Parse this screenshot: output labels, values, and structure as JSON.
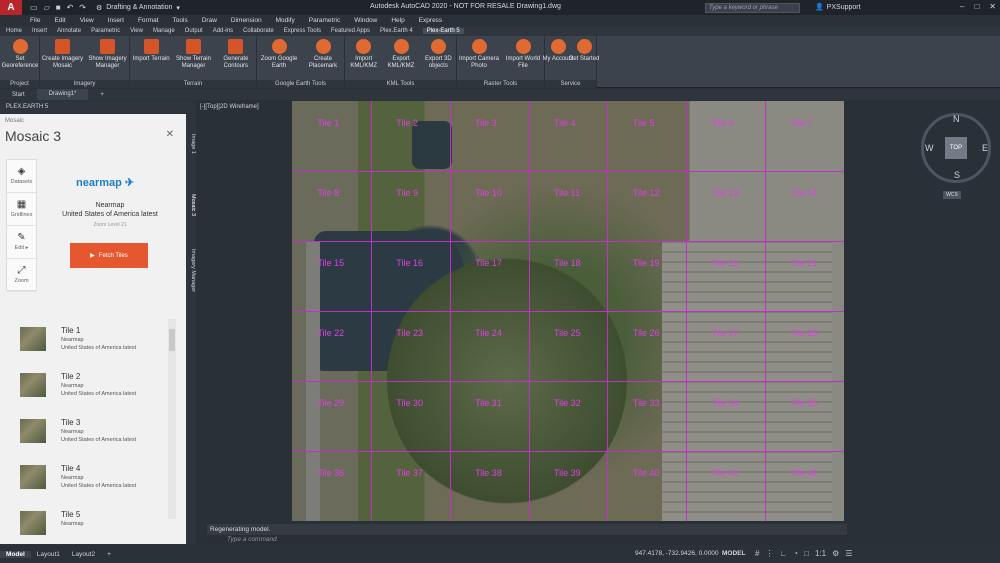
{
  "titlebar": {
    "logo": "A",
    "workspace": "Drafting & Annotation",
    "app_title": "Autodesk AutoCAD 2020 - NOT FOR RESALE   Drawing1.dwg",
    "search_placeholder": "Type a keyword or phrase",
    "user": "PXSupport"
  },
  "menubar": [
    "File",
    "Edit",
    "View",
    "Insert",
    "Format",
    "Tools",
    "Draw",
    "Dimension",
    "Modify",
    "Parametric",
    "Window",
    "Help",
    "Express"
  ],
  "ribbon_tabs": [
    "Home",
    "Insert",
    "Annotate",
    "Parametric",
    "View",
    "Manage",
    "Output",
    "Add-ins",
    "Collaborate",
    "Express Tools",
    "Featured Apps",
    "Plex.Earth 4",
    "Plex-Earth 5"
  ],
  "ribbon": {
    "groups": [
      {
        "label": "Project",
        "buttons": [
          "Set Georeference"
        ]
      },
      {
        "label": "Imagery",
        "buttons": [
          "Create Imagery Mosaic",
          "Show Imagery Manager"
        ]
      },
      {
        "label": "Terrain",
        "buttons": [
          "Import Terrain",
          "Show Terrain Manager",
          "Generate Contours"
        ]
      },
      {
        "label": "Google Earth Tools",
        "buttons": [
          "Zoom Google Earth",
          "Create Placemark"
        ]
      },
      {
        "label": "KML Tools",
        "buttons": [
          "Import KML/KMZ",
          "Export KML/KMZ",
          "Export 3D objects"
        ]
      },
      {
        "label": "Raster Tools",
        "buttons": [
          "Import Camera Photo",
          "Import World File"
        ]
      },
      {
        "label": "Service",
        "buttons": [
          "My Account",
          "Get Started"
        ]
      }
    ]
  },
  "doc_tabs": [
    "Start",
    "Drawing1*"
  ],
  "panel": {
    "header": "PLEX.EARTH 5",
    "crumb": "Mosaic",
    "title": "Mosaic 3",
    "tools": [
      "Datasets",
      "Gridlines",
      "Edit",
      "Zoom"
    ],
    "provider_logo": "nearmap",
    "provider_name": "Nearmap",
    "provider_sub": "United States of America latest",
    "zoom_level": "Zoom Level 21",
    "fetch_label": "Fetch Tiles",
    "tiles": [
      {
        "name": "Tile 1",
        "provider": "Nearmap",
        "region": "United States of America latest"
      },
      {
        "name": "Tile 2",
        "provider": "Nearmap",
        "region": "United States of America latest"
      },
      {
        "name": "Tile 3",
        "provider": "Nearmap",
        "region": "United States of America latest"
      },
      {
        "name": "Tile 4",
        "provider": "Nearmap",
        "region": "United States of America latest"
      },
      {
        "name": "Tile 5",
        "provider": "Nearmap",
        "region": ""
      }
    ],
    "vertical_tabs": [
      "Image 1",
      "Mosaic 3",
      "Imagery Manager"
    ]
  },
  "viewport": {
    "label": "[-][Top][2D Wireframe]",
    "tile_labels": [
      "Tile 1",
      "Tile 2",
      "Tile 3",
      "Tile 4",
      "Tile 5",
      "Tile 6",
      "Tile 7",
      "Tile 8",
      "Tile 9",
      "Tile 10",
      "Tile 11",
      "Tile 12",
      "Tile 13",
      "Tile 14",
      "Tile 15",
      "Tile 16",
      "Tile 17",
      "Tile 18",
      "Tile 19",
      "Tile 20",
      "Tile 21",
      "Tile 22",
      "Tile 23",
      "Tile 24",
      "Tile 25",
      "Tile 26",
      "Tile 27",
      "Tile 28",
      "Tile 29",
      "Tile 30",
      "Tile 31",
      "Tile 32",
      "Tile 33",
      "Tile 34",
      "Tile 35",
      "Tile 36",
      "Tile 37",
      "Tile 38",
      "Tile 39",
      "Tile 40",
      "Tile 41",
      "Tile 42"
    ],
    "compass": {
      "n": "N",
      "s": "S",
      "e": "E",
      "w": "W",
      "center": "TOP",
      "wcs": "WCS"
    }
  },
  "command": {
    "history": "Regenerating model.",
    "placeholder": "Type a command"
  },
  "status": {
    "layouts": [
      "Model",
      "Layout1",
      "Layout2"
    ],
    "coords": "947.4178, -732.9426, 0.0000",
    "model": "MODEL",
    "scale": "1:1"
  }
}
